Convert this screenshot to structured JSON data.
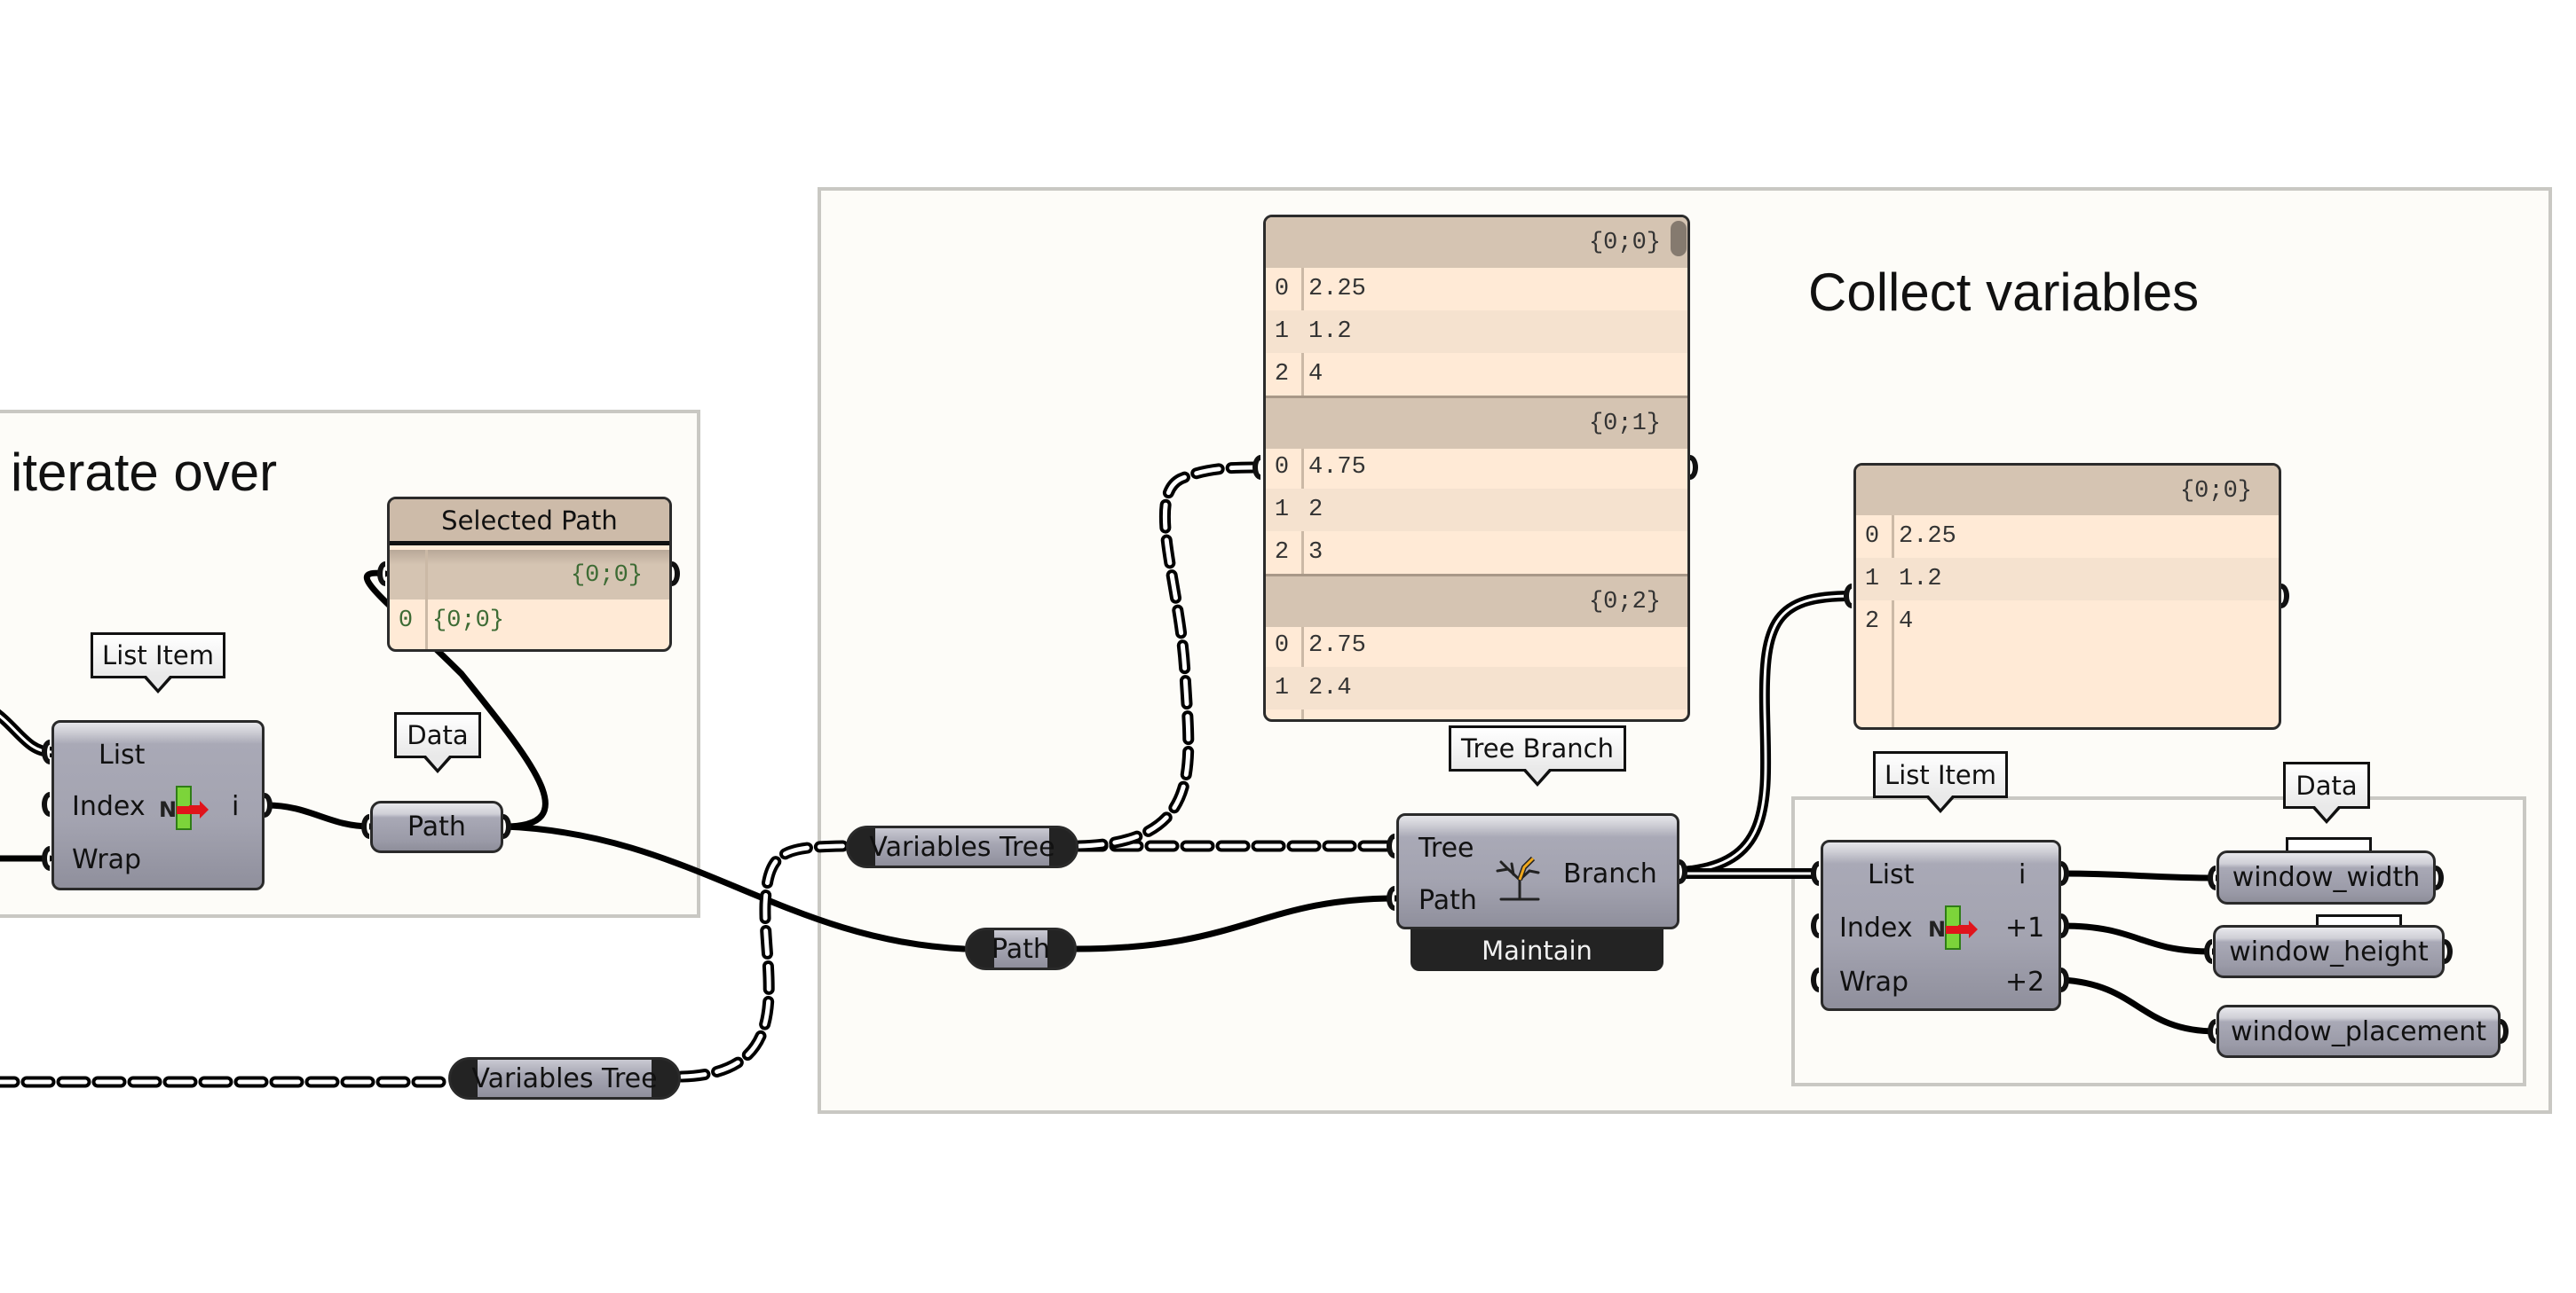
{
  "groups": {
    "left": {
      "title": "iterate over"
    },
    "right": {
      "title": "Collect variables"
    }
  },
  "left_group": {
    "list_item_tag": "List Item",
    "list_item": {
      "inputs": [
        "List",
        "Index",
        "Wrap"
      ],
      "output": "i",
      "icon": "list-item-icon"
    },
    "data_tag": "Data",
    "path_param": "Path",
    "selected_path_panel": {
      "title": "Selected Path",
      "branch": "{0;0}",
      "rows": [
        {
          "index": "0",
          "value": "{0;0}"
        }
      ]
    }
  },
  "relays": {
    "variables_tree_top": "Variables Tree",
    "variables_tree_bottom": "Variables Tree",
    "path": "Path"
  },
  "variables_panel": {
    "branches": [
      {
        "path": "{0;0}",
        "rows": [
          {
            "index": "0",
            "value": "2.25"
          },
          {
            "index": "1",
            "value": "1.2"
          },
          {
            "index": "2",
            "value": "4"
          }
        ]
      },
      {
        "path": "{0;1}",
        "rows": [
          {
            "index": "0",
            "value": "4.75"
          },
          {
            "index": "1",
            "value": "2"
          },
          {
            "index": "2",
            "value": "3"
          }
        ]
      },
      {
        "path": "{0;2}",
        "rows": [
          {
            "index": "0",
            "value": "2.75"
          },
          {
            "index": "1",
            "value": "2.4"
          }
        ]
      }
    ]
  },
  "tree_branch": {
    "tag": "Tree Branch",
    "inputs": [
      "Tree",
      "Path"
    ],
    "output": "Branch",
    "mode": "Maintain",
    "icon": "tree-branch-icon"
  },
  "branch_panel": {
    "path": "{0;0}",
    "rows": [
      {
        "index": "0",
        "value": "2.25"
      },
      {
        "index": "1",
        "value": "1.2"
      },
      {
        "index": "2",
        "value": "4"
      }
    ]
  },
  "right_list_item": {
    "tag": "List Item",
    "inputs": [
      "List",
      "Index",
      "Wrap"
    ],
    "outputs": [
      "i",
      "+1",
      "+2"
    ],
    "icon": "list-item-icon"
  },
  "data_tag_right": "Data",
  "outputs": [
    "window_width",
    "window_height",
    "window_placement"
  ],
  "colors": {
    "canvas": "#ffffff",
    "group_fill": "#fdfcf8",
    "group_border": "#c9c8c3",
    "panel_fill": "#ffead6",
    "panel_header": "#d5c4b2",
    "component": "#a3a3b0",
    "wire": "#000000"
  }
}
